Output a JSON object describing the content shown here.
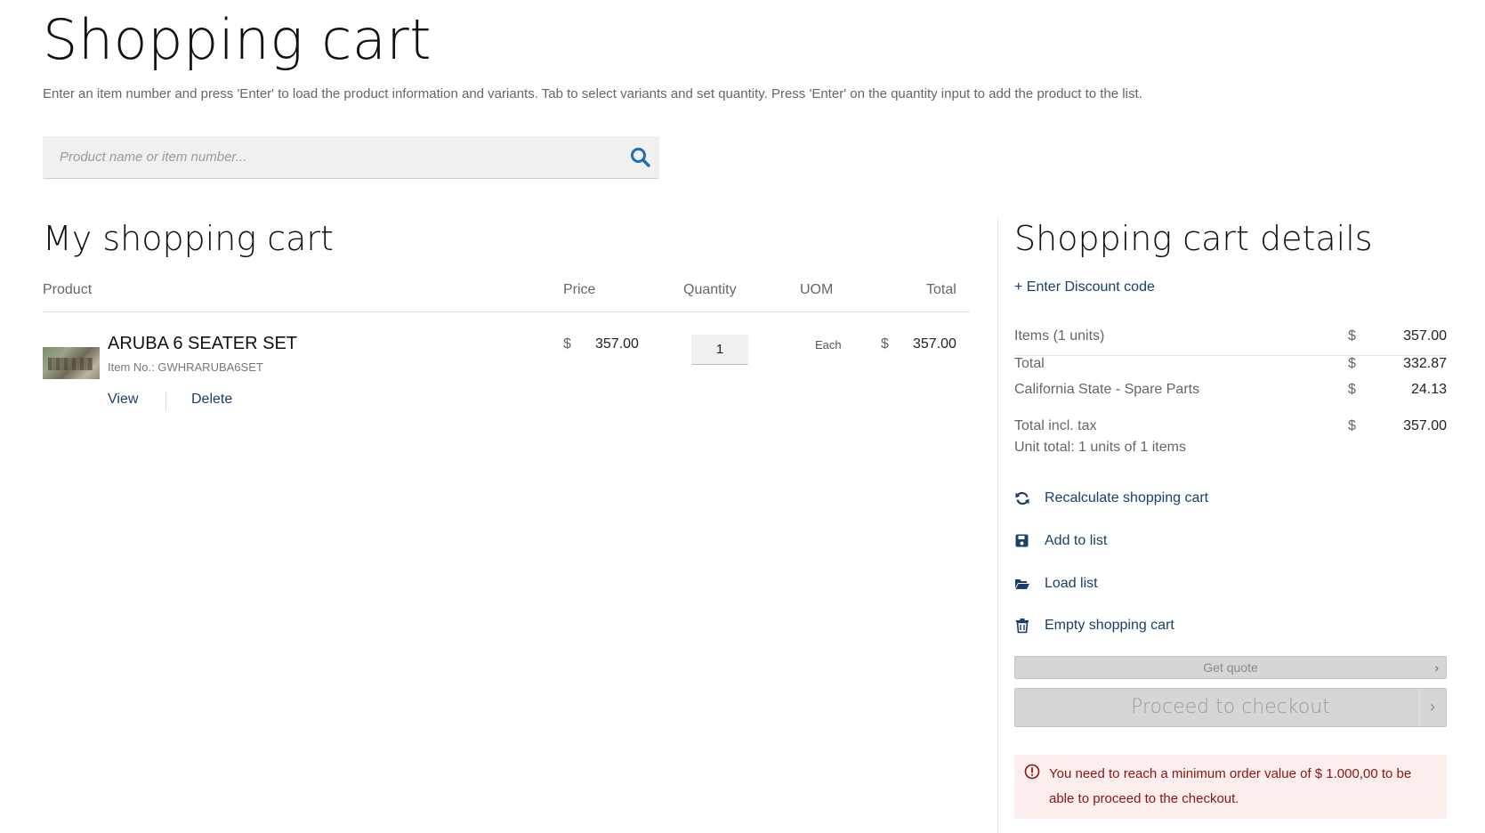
{
  "page": {
    "title": "Shopping cart",
    "intro": "Enter an item number and press 'Enter' to load the product information and variants. Tab to select variants and set quantity. Press 'Enter' on the quantity input to add the product to the list."
  },
  "search": {
    "placeholder": "Product name or item number...",
    "icon": "search-icon"
  },
  "cart": {
    "heading": "My shopping cart",
    "columns": {
      "product": "Product",
      "price": "Price",
      "quantity": "Quantity",
      "uom": "UOM",
      "total": "Total"
    },
    "items": [
      {
        "name": "ARUBA 6 SEATER SET",
        "item_no": "Item No.: GWHRARUBA6SET",
        "currency": "$",
        "price": "357.00",
        "quantity": "1",
        "uom": "Each",
        "total": "357.00",
        "view_label": "View",
        "delete_label": "Delete"
      }
    ]
  },
  "details": {
    "heading": "Shopping cart details",
    "discount_label": "+ Enter Discount code",
    "currency": "$",
    "rows": [
      {
        "label": "Items (1 units)",
        "value": "357.00"
      },
      {
        "label": "Total",
        "value": "332.87"
      },
      {
        "label": "California State - Spare Parts",
        "value": "24.13"
      },
      {
        "label": "Total incl. tax",
        "value": "357.00"
      }
    ],
    "unit_total": "Unit total: 1 units of 1 items",
    "actions": [
      {
        "label": "Recalculate shopping cart",
        "icon": "refresh-icon"
      },
      {
        "label": "Add to list",
        "icon": "save-icon"
      },
      {
        "label": "Load list",
        "icon": "folder-open-icon"
      },
      {
        "label": "Empty shopping cart",
        "icon": "trash-icon"
      }
    ],
    "get_quote_label": "Get quote",
    "checkout_label": "Proceed to checkout",
    "chevron": "›",
    "alert": "You need to reach a minimum order value of $ 1.000,00 to be able to proceed to the checkout.",
    "colors": {
      "link": "#1a3f6b",
      "alert_text": "#8b1414",
      "alert_bg": "#fbeeed",
      "search_icon": "#1f6fb5"
    }
  }
}
